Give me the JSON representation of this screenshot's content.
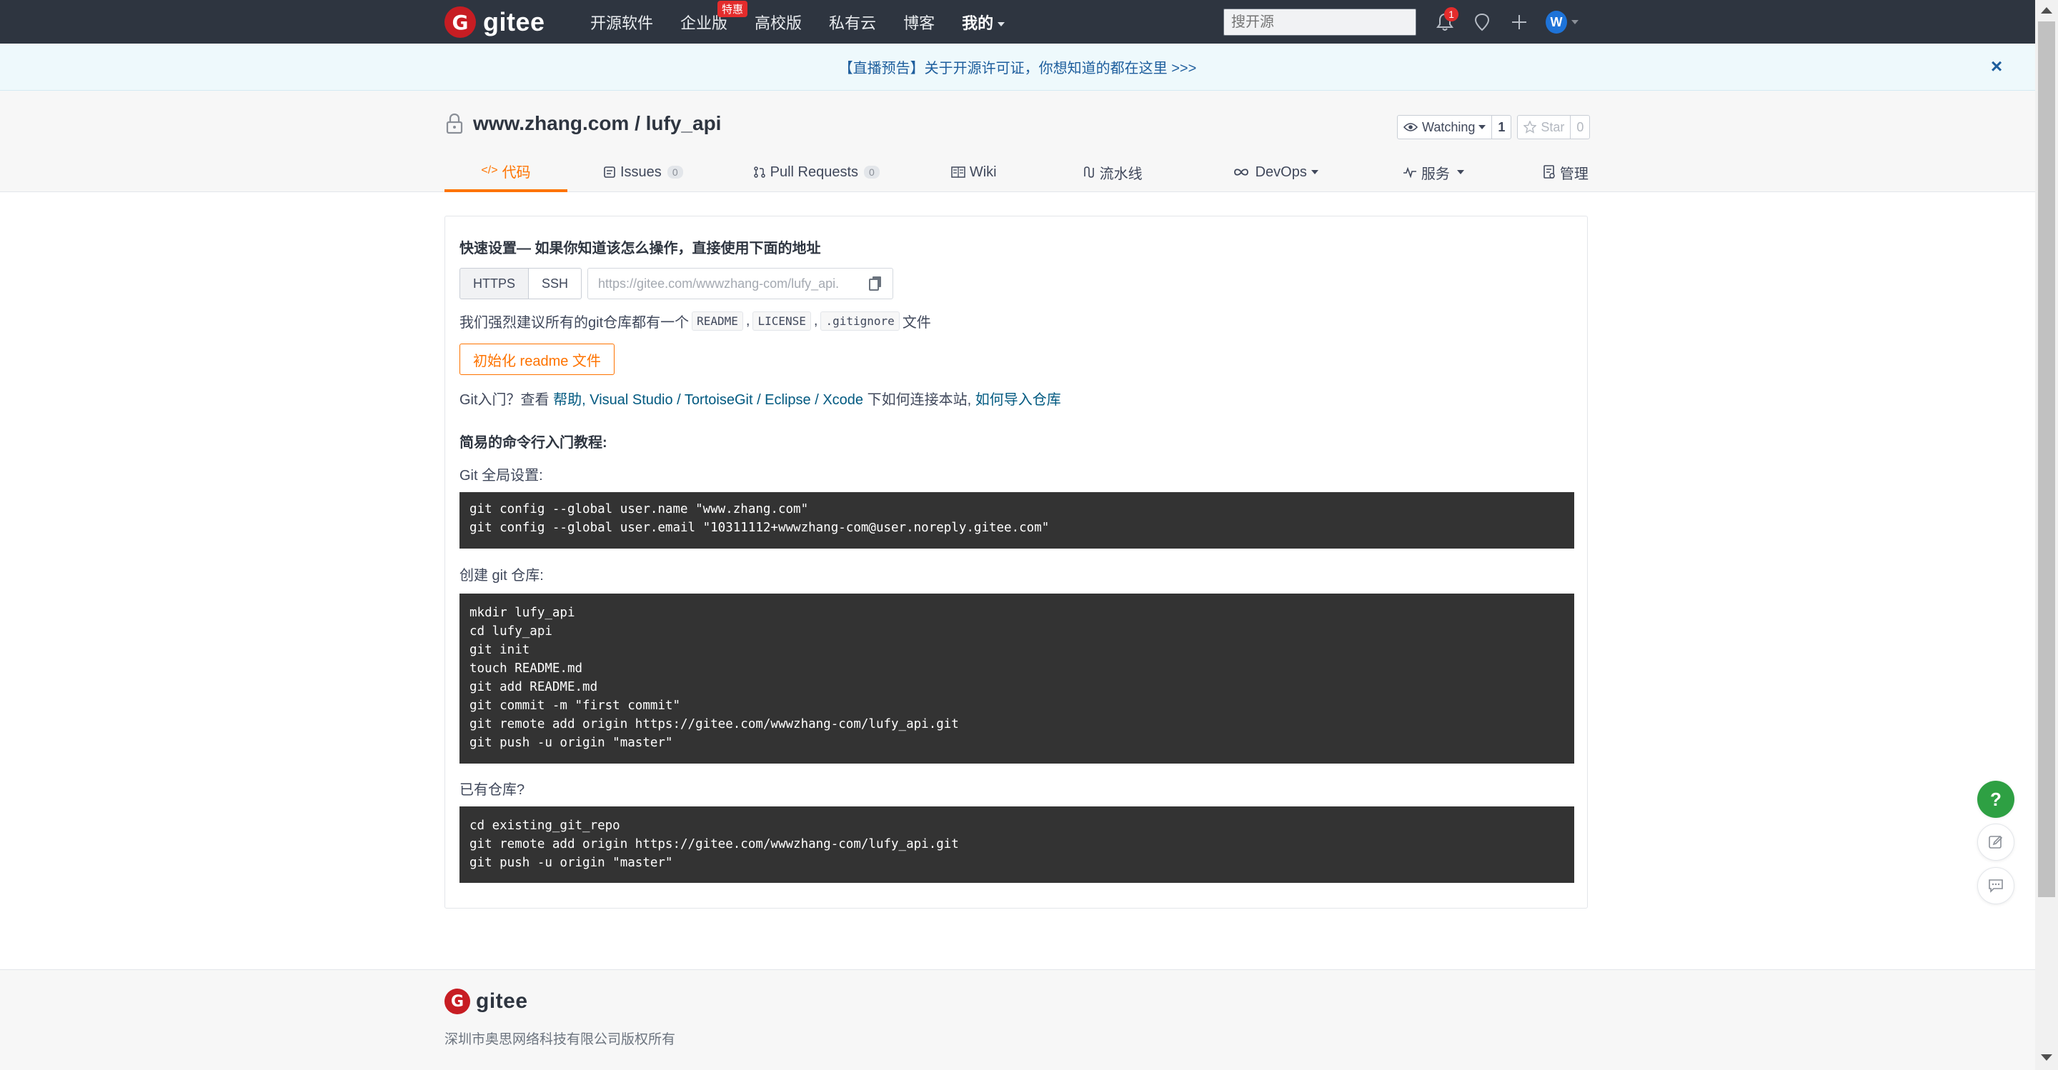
{
  "nav": {
    "logo_text": "gitee",
    "links": [
      "开源软件",
      "企业版",
      "高校版",
      "私有云",
      "博客"
    ],
    "enterprise_badge": "特惠",
    "mine_label": "我的",
    "search_placeholder": "搜开源",
    "notification_count": "1",
    "avatar_letter": "W"
  },
  "banner": {
    "text": "【直播预告】关于开源许可证，你想知道的都在这里 >>>",
    "close_symbol": "×"
  },
  "repo": {
    "title": "www.zhang.com / lufy_api",
    "watch_label": "Watching",
    "watch_count": "1",
    "star_label": "Star",
    "star_count": "0"
  },
  "tabs": [
    {
      "label": "代码",
      "icon": "</>"
    },
    {
      "label": "Issues",
      "count": "0"
    },
    {
      "label": "Pull Requests",
      "count": "0"
    },
    {
      "label": "Wiki"
    },
    {
      "label": "流水线"
    },
    {
      "label": "DevOps"
    },
    {
      "label": "服务"
    },
    {
      "label": "管理"
    }
  ],
  "quick_setup": {
    "title": "快速设置— 如果你知道该怎么操作，直接使用下面的地址",
    "https_label": "HTTPS",
    "ssh_label": "SSH",
    "url_value": "https://gitee.com/wwwzhang-com/lufy_api.",
    "suggest_prefix": "我们强烈建议所有的git仓库都有一个",
    "suggest_files": [
      "README",
      "LICENSE",
      ".gitignore"
    ],
    "suggest_sep": ",",
    "suggest_suffix": "文件",
    "init_button": "初始化 readme 文件",
    "intro_prefix": "Git入门？查看",
    "intro_help": "帮助",
    "intro_tools": ", Visual Studio / TortoiseGit / Eclipse / Xcode",
    "intro_mid": "下如何连接本站,",
    "intro_import": "如何导入仓库"
  },
  "tutorial": {
    "title": "简易的命令行入门教程:",
    "global_label": "Git 全局设置:",
    "global_code": "git config --global user.name \"www.zhang.com\"\ngit config --global user.email \"10311112+wwwzhang-com@user.noreply.gitee.com\"",
    "create_label": "创建 git 仓库:",
    "create_code": "mkdir lufy_api\ncd lufy_api\ngit init\ntouch README.md\ngit add README.md\ngit commit -m \"first commit\"\ngit remote add origin https://gitee.com/wwwzhang-com/lufy_api.git\ngit push -u origin \"master\"",
    "existing_label": "已有仓库?",
    "existing_code": "cd existing_git_repo\ngit remote add origin https://gitee.com/wwwzhang-com/lufy_api.git\ngit push -u origin \"master\""
  },
  "float": {
    "help_symbol": "?"
  },
  "footer": {
    "logo_text": "gitee",
    "copyright": "深圳市奥思网络科技有限公司版权所有"
  },
  "colors": {
    "nav_bg": "#2e3540",
    "accent": "#fe7300",
    "brand_red": "#c71d23",
    "link": "#005980"
  }
}
